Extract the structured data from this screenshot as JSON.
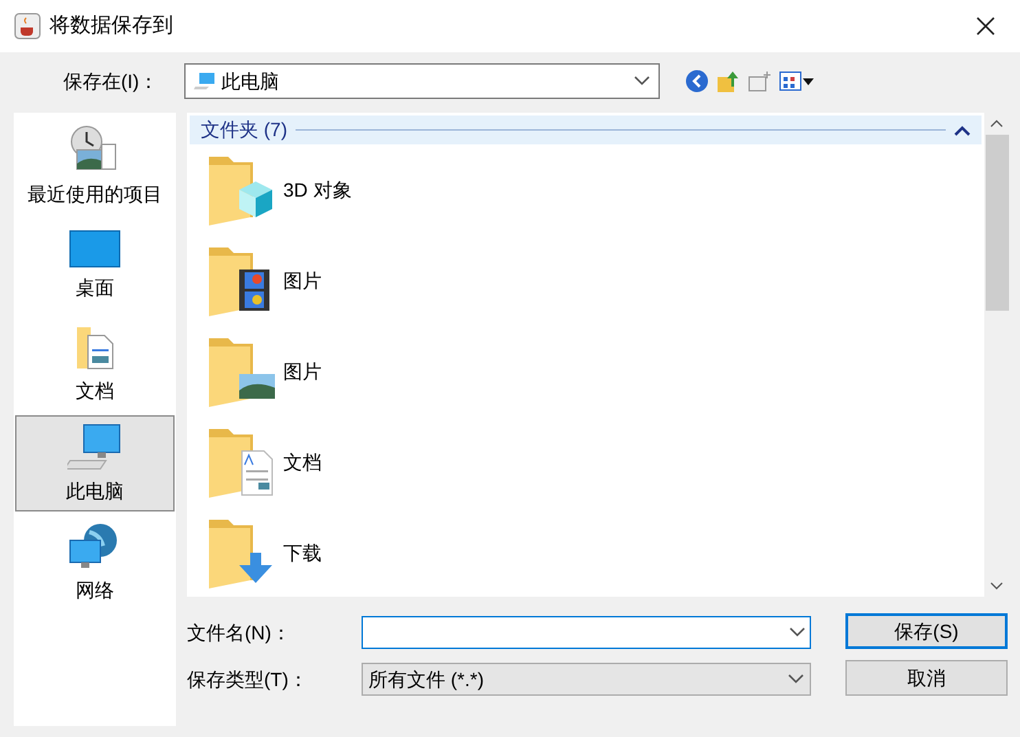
{
  "window": {
    "title": "将数据保存到"
  },
  "location": {
    "label": "保存在(I)：",
    "value": "此电脑"
  },
  "sidebar": {
    "items": [
      {
        "label": "最近使用的项目",
        "kind": "recent",
        "selected": false
      },
      {
        "label": "桌面",
        "kind": "desktop",
        "selected": false
      },
      {
        "label": "文档",
        "kind": "documents",
        "selected": false
      },
      {
        "label": "此电脑",
        "kind": "computer",
        "selected": true
      },
      {
        "label": "网络",
        "kind": "network",
        "selected": false
      }
    ]
  },
  "group": {
    "title": "文件夹 (7)",
    "expanded": true
  },
  "folders": [
    {
      "name": "3D 对象",
      "kind": "cube"
    },
    {
      "name": "图片",
      "kind": "video"
    },
    {
      "name": "图片",
      "kind": "photo"
    },
    {
      "name": "文档",
      "kind": "doc"
    },
    {
      "name": "下载",
      "kind": "download"
    }
  ],
  "file_name": {
    "label": "文件名(N)："
  },
  "file_type": {
    "label": "保存类型(T)：",
    "value": "所有文件 (*.*)"
  },
  "buttons": [
    {
      "label": "保存(S)",
      "default": true
    },
    {
      "label": "取消",
      "default": false
    }
  ]
}
